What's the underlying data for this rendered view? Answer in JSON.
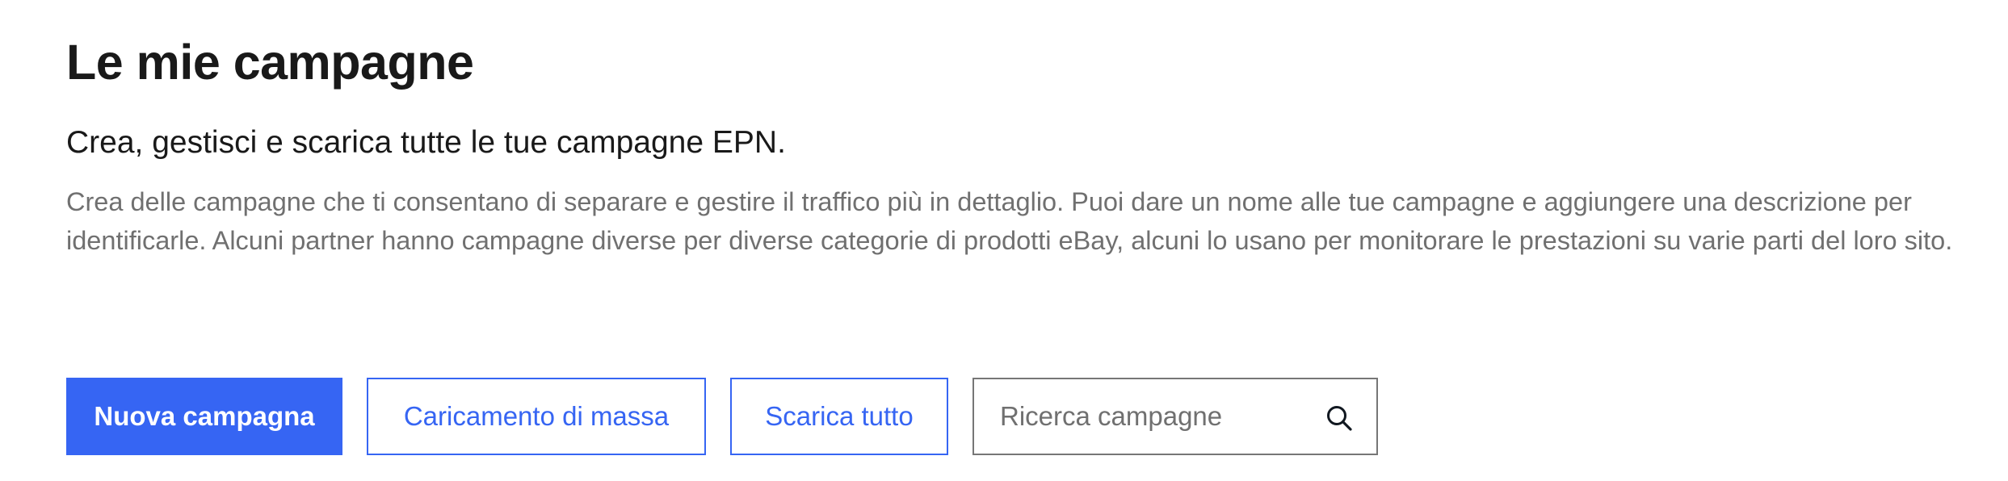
{
  "header": {
    "title": "Le mie campagne",
    "subtitle": "Crea, gestisci e scarica tutte le tue campagne EPN.",
    "description": "Crea delle campagne che ti consentano di separare e gestire il traffico più in dettaglio. Puoi dare un nome alle tue campagne e aggiungere una descrizione per identificarle. Alcuni partner hanno campagne diverse per diverse categorie di prodotti eBay, alcuni lo usano per monitorare le prestazioni su varie parti del loro sito."
  },
  "actions": {
    "new_campaign_label": "Nuova campagna",
    "bulk_upload_label": "Caricamento di massa",
    "download_all_label": "Scarica tutto"
  },
  "search": {
    "placeholder": "Ricerca campagne",
    "value": "",
    "icon": "search-icon"
  },
  "colors": {
    "accent": "#3665f3",
    "text_primary": "#191919",
    "text_secondary": "#707070",
    "input_border": "#767676"
  }
}
